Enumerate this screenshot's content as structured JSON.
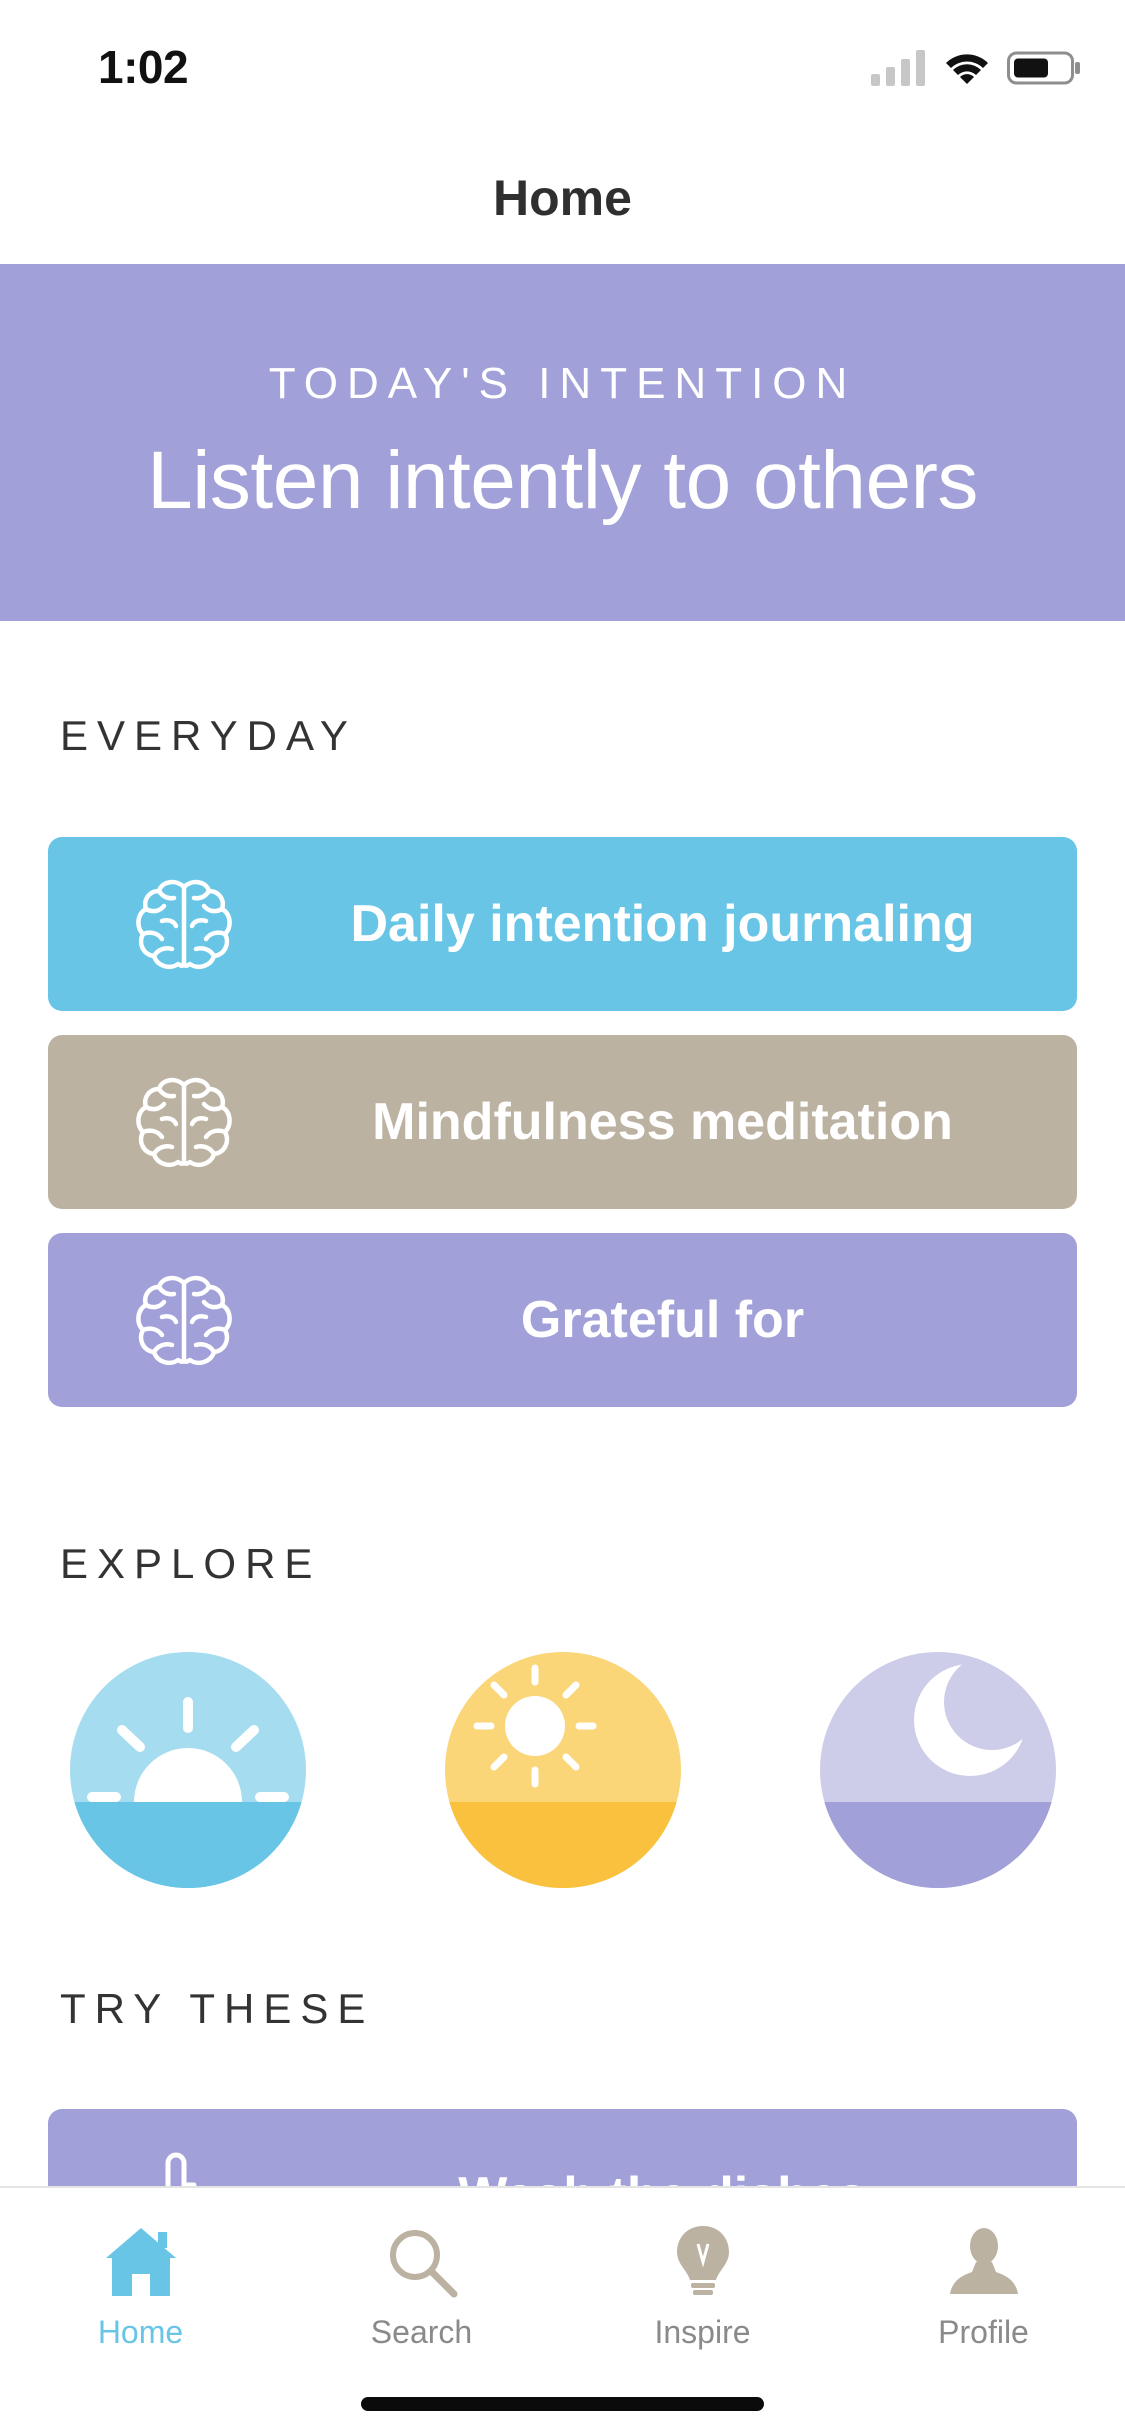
{
  "status_bar": {
    "time": "1:02"
  },
  "nav": {
    "title": "Home"
  },
  "intention": {
    "label": "TODAY'S INTENTION",
    "text": "Listen intently to others"
  },
  "everyday": {
    "title": "EVERYDAY",
    "items": [
      {
        "label": "Daily intention journaling",
        "color": "#69c5e6",
        "icon": "brain-icon"
      },
      {
        "label": "Mindfulness meditation",
        "color": "#bbb2a2",
        "icon": "brain-icon"
      },
      {
        "label": "Grateful for",
        "color": "#a1a0d8",
        "icon": "brain-icon"
      }
    ]
  },
  "explore": {
    "title": "EXPLORE",
    "items": [
      {
        "name": "sunrise",
        "icon": "sunrise-icon"
      },
      {
        "name": "sun",
        "icon": "sun-icon"
      },
      {
        "name": "moon",
        "icon": "moon-icon"
      }
    ]
  },
  "try_these": {
    "title": "TRY THESE",
    "items": [
      {
        "label": "Wash the dishes",
        "color": "#a1a0d8",
        "icon": "pointing-hand-icon"
      }
    ]
  },
  "tabs": [
    {
      "label": "Home",
      "icon": "home-icon",
      "active": true
    },
    {
      "label": "Search",
      "icon": "search-icon",
      "active": false
    },
    {
      "label": "Inspire",
      "icon": "lightbulb-icon",
      "active": false
    },
    {
      "label": "Profile",
      "icon": "profile-icon",
      "active": false
    }
  ],
  "colors": {
    "accent_blue": "#69c5e6",
    "lavender": "#a1a0d8",
    "taupe": "#bbb2a2",
    "sun_yellow": "#f9c13d",
    "tab_inactive": "#8a8a8a"
  }
}
